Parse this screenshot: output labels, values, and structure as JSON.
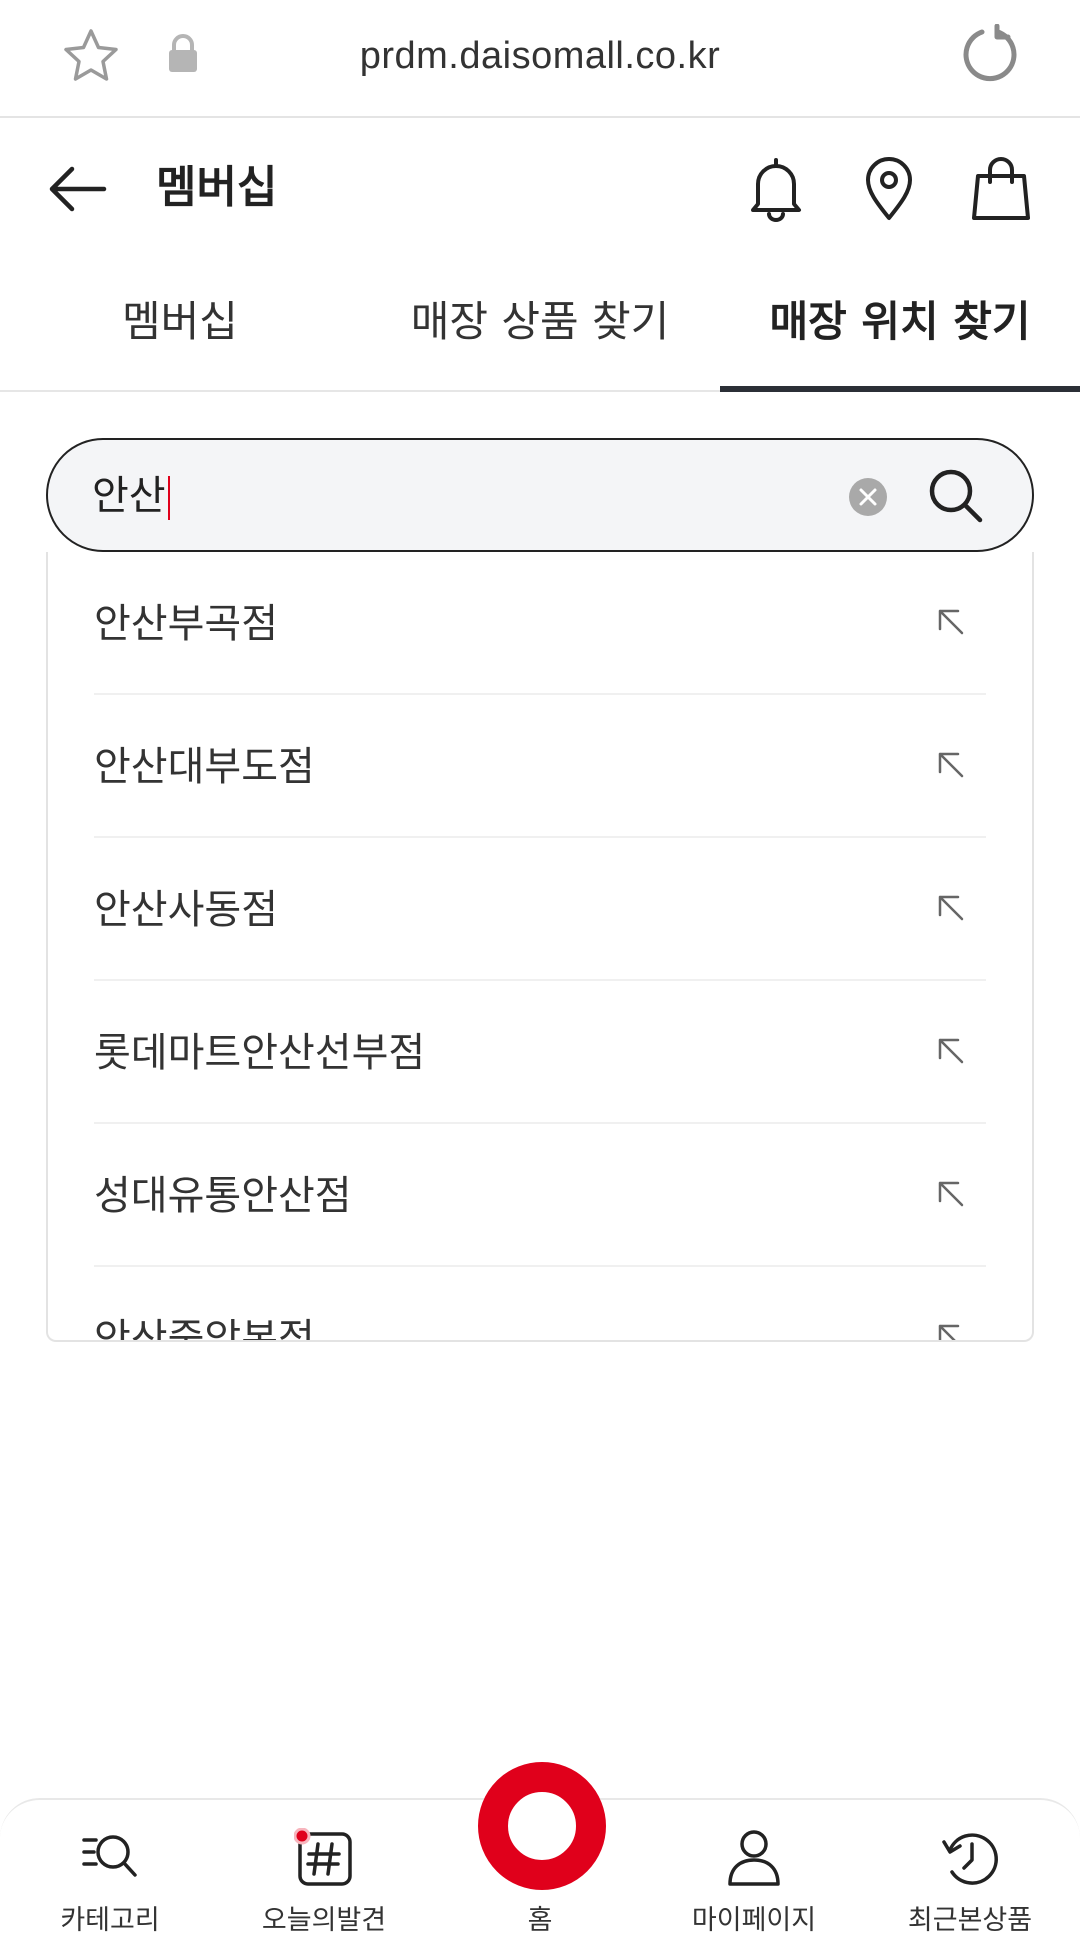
{
  "browser": {
    "url": "prdm.daisomall.co.kr"
  },
  "header": {
    "title": "멤버십"
  },
  "tabs": [
    {
      "label": "멤버십",
      "active": false
    },
    {
      "label": "매장 상품 찾기",
      "active": false
    },
    {
      "label": "매장 위치 찾기",
      "active": true
    }
  ],
  "search": {
    "value": "안산"
  },
  "suggestions": [
    "안산부곡점",
    "안산대부도점",
    "안산사동점",
    "롯데마트안산선부점",
    "성대유통안산점",
    "안산중앙본점"
  ],
  "bottom_nav": [
    {
      "label": "카테고리",
      "icon": "category-search-icon"
    },
    {
      "label": "오늘의발견",
      "icon": "hashtag-icon"
    },
    {
      "label": "홈",
      "icon": "home-ring-icon"
    },
    {
      "label": "마이페이지",
      "icon": "person-icon"
    },
    {
      "label": "최근본상품",
      "icon": "history-icon"
    }
  ],
  "colors": {
    "accent": "#e0001b",
    "tab_indicator": "#2b2f36"
  }
}
